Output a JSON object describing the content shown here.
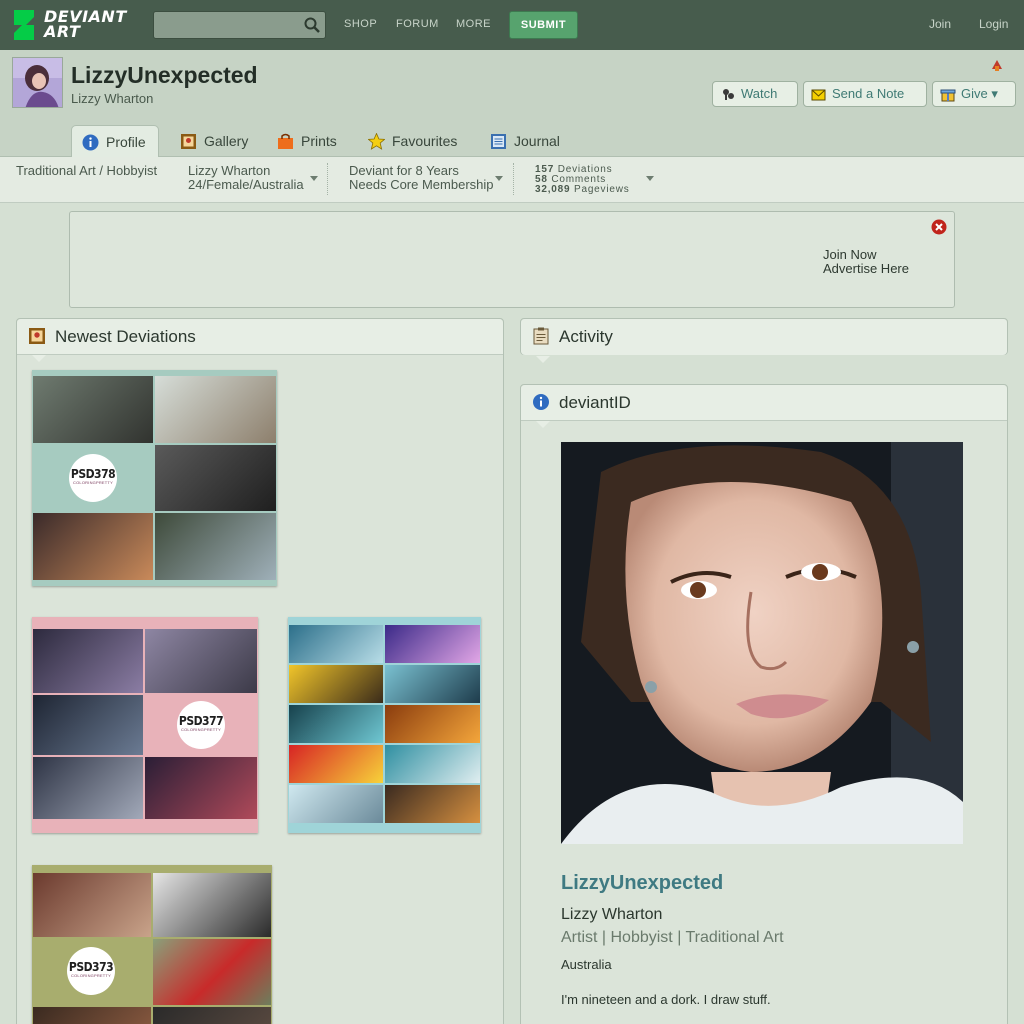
{
  "topbar": {
    "logo_line1": "DEVIANT",
    "logo_line2": "ART",
    "search_placeholder": "",
    "nav": [
      "SHOP",
      "FORUM",
      "MORE"
    ],
    "submit_label": "SUBMIT",
    "join_label": "Join",
    "login_label": "Login"
  },
  "profile": {
    "username": "LizzyUnexpected",
    "realname": "Lizzy Wharton",
    "watch_label": "Watch",
    "note_label": "Send a Note",
    "give_label": "Give ▾"
  },
  "tabs": [
    "Profile",
    "Gallery",
    "Prints",
    "Favourites",
    "Journal"
  ],
  "stats": {
    "category": "Traditional Art / Hobbyist",
    "name": "Lizzy Wharton",
    "asl": "24/Female/Australia",
    "deviant_for": "Deviant for 8 Years",
    "membership": "Needs Core Membership",
    "deviations_num": "157",
    "deviations_label": "Deviations",
    "comments_num": "58",
    "comments_label": "Comments",
    "pageviews_num": "32,089",
    "pageviews_label": "Pageviews"
  },
  "ad": {
    "join_now": "Join Now",
    "advertise": "Advertise Here"
  },
  "panels": {
    "newest": "Newest Deviations",
    "activity": "Activity",
    "deviantid": "deviantID"
  },
  "thumbs": [
    {
      "badge": "PSD378",
      "sub": "COLORINGPRETTY",
      "bg": "#a6cbc0"
    },
    {
      "badge": "PSD377",
      "sub": "COLORINGPRETTY",
      "bg": "#e8b2b9"
    },
    {
      "badge": "",
      "sub": "",
      "bg": "#9fd4d8"
    },
    {
      "badge": "PSD373",
      "sub": "COLORINGPRETTY",
      "bg": "#a8ad6e"
    }
  ],
  "deviantid": {
    "username": "LizzyUnexpected",
    "realname": "Lizzy Wharton",
    "tags": "Artist  |  Hobbyist  |  Traditional Art",
    "location": "Australia",
    "bio": "I'm nineteen and a dork. I draw stuff."
  },
  "colors": {
    "topbar": "#475c4d",
    "submit": "#57a36e",
    "page_bg": "#d5e0d3",
    "link": "#3f7a82"
  }
}
